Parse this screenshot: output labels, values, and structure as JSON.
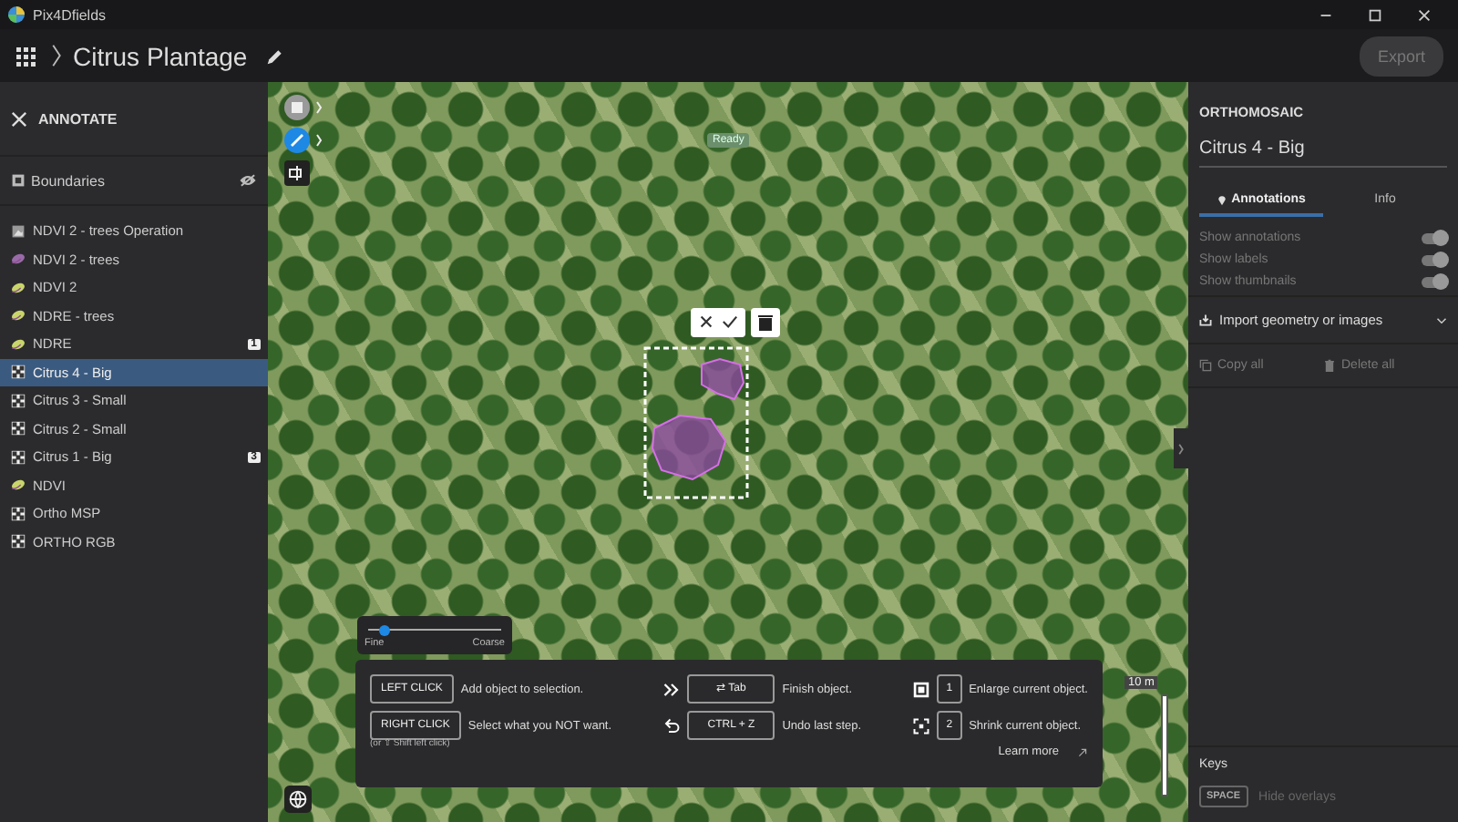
{
  "window": {
    "title": "Pix4Dfields"
  },
  "header": {
    "project": "Citrus Plantage",
    "export_button": "Export",
    "export_disabled": true
  },
  "sidebar": {
    "title": "ANNOTATE",
    "boundaries": {
      "label": "Boundaries",
      "visible": false
    },
    "layers": [
      {
        "label": "NDVI 2 - trees Operation",
        "kind": "thumbnail",
        "selected": false
      },
      {
        "label": "NDVI 2 - trees",
        "kind": "purple-leaf",
        "selected": false
      },
      {
        "label": "NDVI 2",
        "kind": "yellow-leaf",
        "selected": false
      },
      {
        "label": "NDRE - trees",
        "kind": "yellow-leaf",
        "selected": false
      },
      {
        "label": "NDRE",
        "kind": "yellow-leaf",
        "selected": false,
        "badge": "1"
      },
      {
        "label": "Citrus 4 - Big",
        "kind": "grid",
        "selected": true
      },
      {
        "label": "Citrus 3 - Small",
        "kind": "grid",
        "selected": false
      },
      {
        "label": "Citrus 2 - Small",
        "kind": "grid",
        "selected": false
      },
      {
        "label": "Citrus 1 - Big",
        "kind": "grid",
        "selected": false,
        "badge": "3"
      },
      {
        "label": "NDVI",
        "kind": "yellow-leaf",
        "selected": false
      },
      {
        "label": "Ortho MSP",
        "kind": "grid",
        "selected": false
      },
      {
        "label": "ORTHO RGB",
        "kind": "grid",
        "selected": false
      }
    ]
  },
  "map": {
    "status": "Ready",
    "granularity": {
      "min_label": "Fine",
      "max_label": "Coarse",
      "level": 0.12
    },
    "scale": "10 m",
    "help": {
      "rows": [
        {
          "key": "LEFT CLICK",
          "text": "Add object to selection.",
          "kind": "plain"
        },
        {
          "key": "⇄ Tab",
          "text": "Finish object.",
          "kind": "finish"
        },
        {
          "key": "1",
          "text": "Enlarge current object.",
          "kind": "enlarge"
        },
        {
          "key": "RIGHT CLICK",
          "text": "Select what you NOT want.",
          "note": "(or ⇧ Shift left click)",
          "kind": "plain"
        },
        {
          "key": "CTRL + Z",
          "text": "Undo last step.",
          "kind": "undo"
        },
        {
          "key": "2",
          "text": "Shrink current object.",
          "kind": "shrink"
        }
      ],
      "learn_more": "Learn more"
    }
  },
  "panel": {
    "section": "ORTHOMOSAIC",
    "name": "Citrus 4 - Big",
    "tabs": [
      {
        "label": "Annotations",
        "selected": true
      },
      {
        "label": "Info",
        "selected": false
      }
    ],
    "toggles": [
      {
        "label": "Show annotations",
        "on": true
      },
      {
        "label": "Show labels",
        "on": true
      },
      {
        "label": "Show thumbnails",
        "on": true
      }
    ],
    "import": "Import geometry or images",
    "copy_all": "Copy all",
    "delete_all": "Delete all",
    "keys_title": "Keys",
    "keys": [
      {
        "key": "SPACE",
        "text": "Hide overlays"
      }
    ]
  }
}
